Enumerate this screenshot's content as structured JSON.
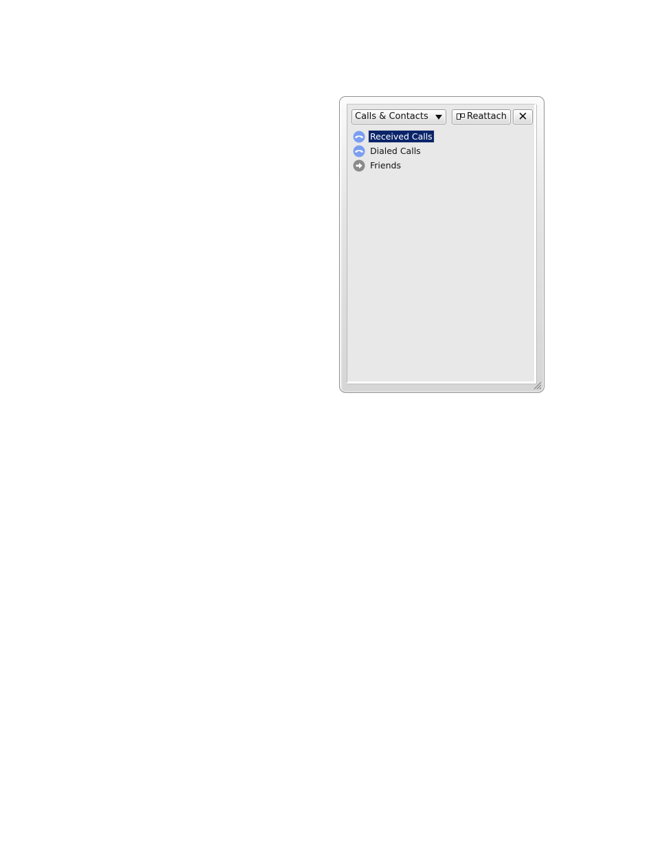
{
  "panel": {
    "view_selector": {
      "label": "Calls & Contacts"
    },
    "reattach_label": "Reattach",
    "close_label": "✕"
  },
  "tree": {
    "items": [
      {
        "label": "Received Calls",
        "icon": "phone-icon",
        "selected": true
      },
      {
        "label": "Dialed Calls",
        "icon": "phone-icon",
        "selected": false
      },
      {
        "label": "Friends",
        "icon": "arrow-right-circle-icon",
        "selected": false
      }
    ]
  },
  "colors": {
    "selection": "#0a246a",
    "phone_icon": "#7b9ef1",
    "friends_icon": "#8a8a8a"
  }
}
